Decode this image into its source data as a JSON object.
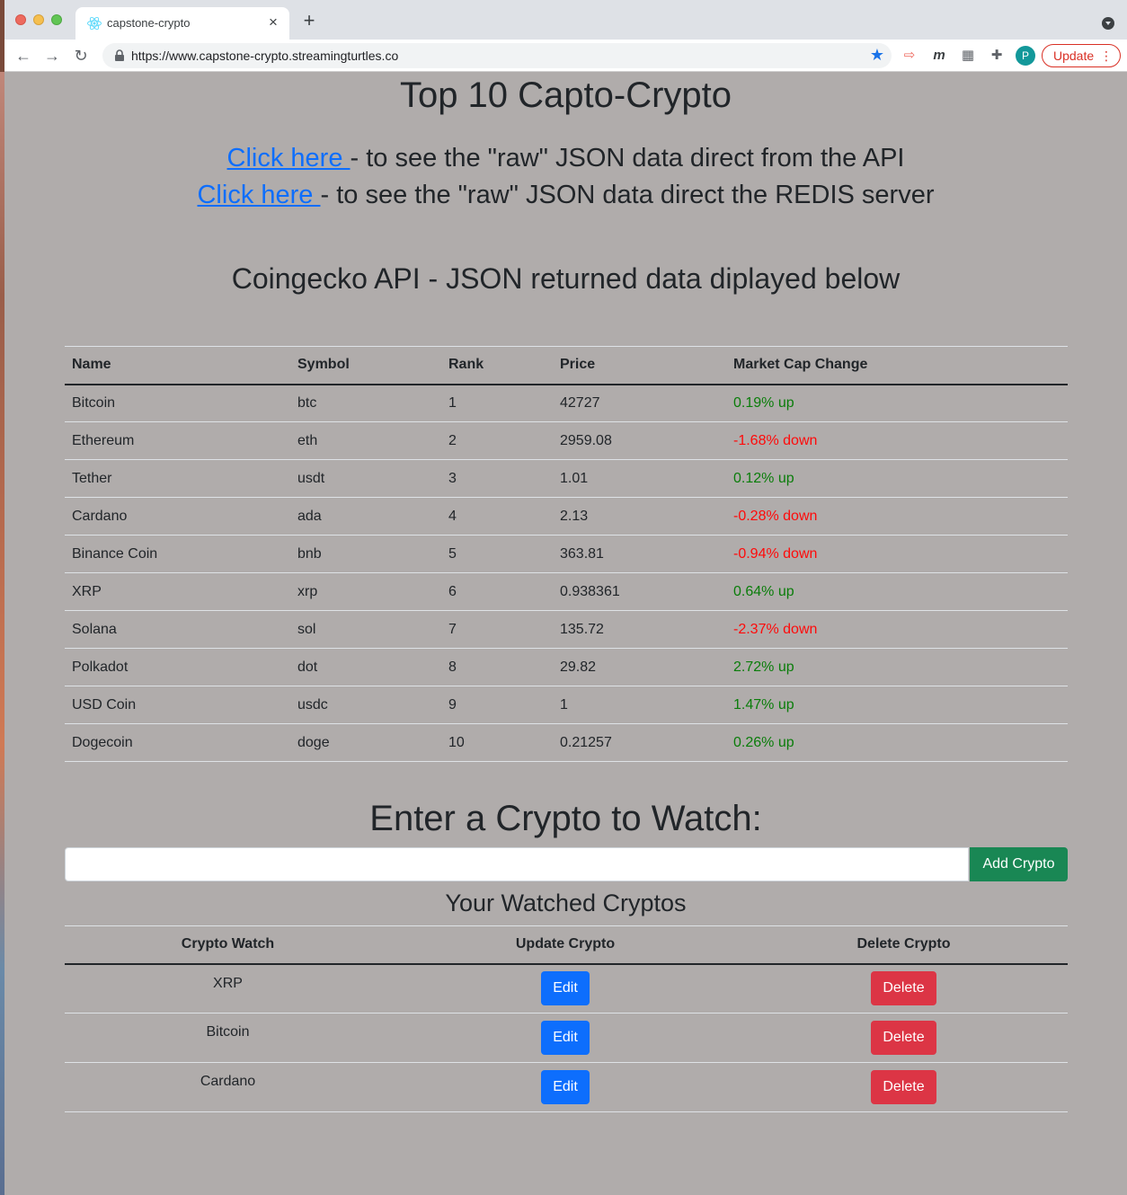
{
  "browser": {
    "tab_title": "capstone-crypto",
    "tab_close": "×",
    "new_tab": "+",
    "url": "https://www.capstone-crypto.streamingturtles.co",
    "update_label": "Update",
    "avatar_letter": "P",
    "extension_m": "m"
  },
  "page": {
    "title": "Top 10 Capto-Crypto",
    "links": [
      {
        "link_text": "Click here ",
        "rest": " - to see the \"raw\" JSON data direct from the API"
      },
      {
        "link_text": "Click here ",
        "rest": " - to see the \"raw\" JSON data direct the REDIS server"
      }
    ],
    "api_heading": "Coingecko API - JSON returned data diplayed below"
  },
  "crypto_table": {
    "headers": [
      "Name",
      "Symbol",
      "Rank",
      "Price",
      "Market Cap Change"
    ],
    "rows": [
      {
        "name": "Bitcoin",
        "symbol": "btc",
        "rank": "1",
        "price": "42727",
        "change": "0.19% up",
        "trend": "up"
      },
      {
        "name": "Ethereum",
        "symbol": "eth",
        "rank": "2",
        "price": "2959.08",
        "change": "-1.68% down",
        "trend": "down"
      },
      {
        "name": "Tether",
        "symbol": "usdt",
        "rank": "3",
        "price": "1.01",
        "change": "0.12% up",
        "trend": "up"
      },
      {
        "name": "Cardano",
        "symbol": "ada",
        "rank": "4",
        "price": "2.13",
        "change": "-0.28% down",
        "trend": "down"
      },
      {
        "name": "Binance Coin",
        "symbol": "bnb",
        "rank": "5",
        "price": "363.81",
        "change": "-0.94% down",
        "trend": "down"
      },
      {
        "name": "XRP",
        "symbol": "xrp",
        "rank": "6",
        "price": "0.938361",
        "change": "0.64% up",
        "trend": "up"
      },
      {
        "name": "Solana",
        "symbol": "sol",
        "rank": "7",
        "price": "135.72",
        "change": "-2.37% down",
        "trend": "down"
      },
      {
        "name": "Polkadot",
        "symbol": "dot",
        "rank": "8",
        "price": "29.82",
        "change": "2.72% up",
        "trend": "up"
      },
      {
        "name": "USD Coin",
        "symbol": "usdc",
        "rank": "9",
        "price": "1",
        "change": "1.47% up",
        "trend": "up"
      },
      {
        "name": "Dogecoin",
        "symbol": "doge",
        "rank": "10",
        "price": "0.21257",
        "change": "0.26% up",
        "trend": "up"
      }
    ]
  },
  "watch": {
    "heading": "Enter a Crypto to Watch:",
    "input_value": "",
    "add_label": "Add Crypto",
    "list_heading": "Your Watched Cryptos",
    "headers": [
      "Crypto Watch",
      "Update Crypto",
      "Delete Crypto"
    ],
    "items": [
      "XRP",
      "Bitcoin",
      "Cardano"
    ],
    "edit_label": "Edit",
    "delete_label": "Delete"
  },
  "colors": {
    "page_bg": "#b0acab",
    "link": "#0d6efd",
    "up": "#0a7d0a",
    "down": "#ff0a0a",
    "add_button": "#198754",
    "edit_button": "#0d6efd",
    "delete_button": "#dc3545"
  }
}
